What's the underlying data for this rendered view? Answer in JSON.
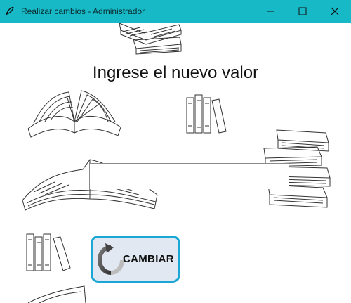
{
  "window": {
    "title": "Realizar cambios - Administrador"
  },
  "form": {
    "prompt": "Ingrese el nuevo valor",
    "value": ""
  },
  "actions": {
    "change_label": "CAMBIAR"
  },
  "colors": {
    "titlebar": "#17b9c7",
    "button_border": "#1aa7d6",
    "button_bg": "#e1e8f2"
  },
  "icons": [
    "feather-icon",
    "minimize-icon",
    "maximize-icon",
    "close-icon",
    "refresh-icon"
  ]
}
